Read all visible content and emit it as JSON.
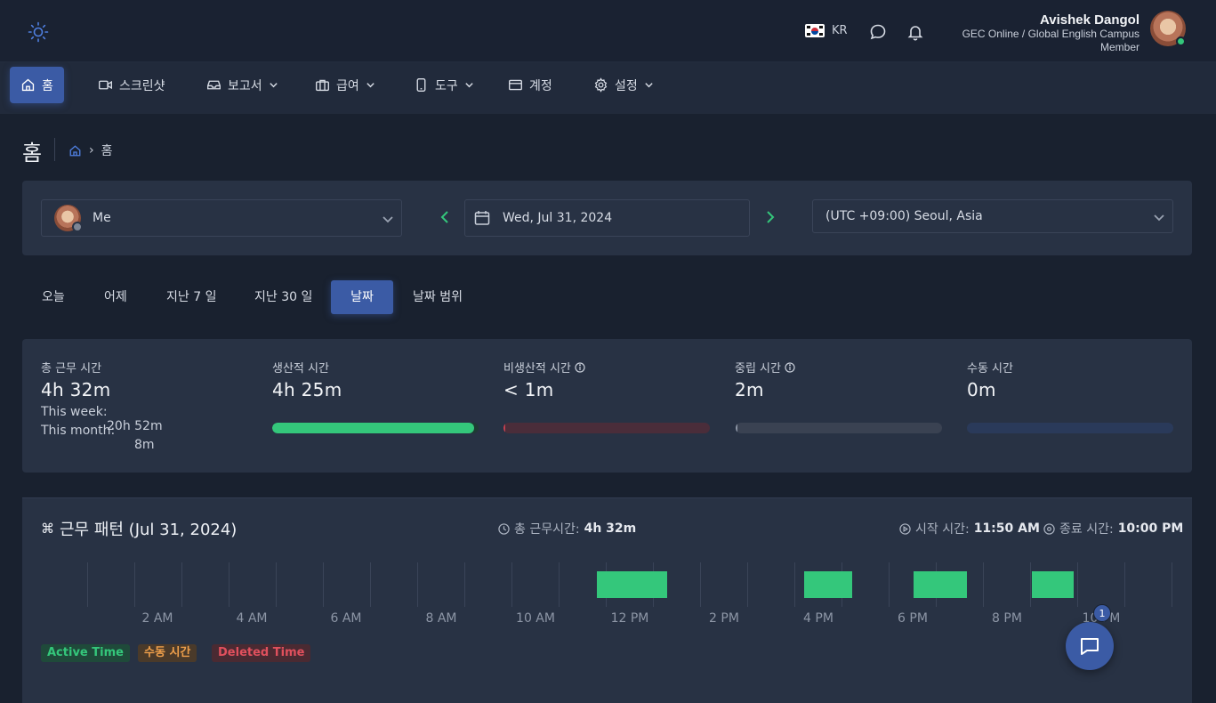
{
  "header": {
    "language_code": "KR",
    "user": {
      "name": "Avishek Dangol",
      "organization": "GEC Online / Global English Campus",
      "role": "Member"
    }
  },
  "nav": {
    "items": [
      {
        "label": "홈",
        "icon": "home-icon",
        "active": true
      },
      {
        "label": "스크린샷",
        "icon": "video-icon"
      },
      {
        "label": "보고서",
        "icon": "inbox-icon",
        "dropdown": true
      },
      {
        "label": "급여",
        "icon": "briefcase-icon",
        "dropdown": true
      },
      {
        "label": "도구",
        "icon": "phone-icon",
        "dropdown": true
      },
      {
        "label": "계정",
        "icon": "card-icon"
      },
      {
        "label": "설정",
        "icon": "gear-icon",
        "dropdown": true
      }
    ]
  },
  "page": {
    "title": "홈",
    "breadcrumb_current": "홈"
  },
  "filters": {
    "member": "Me",
    "date": "Wed, Jul 31, 2024",
    "timezone": "(UTC +09:00) Seoul, Asia"
  },
  "quick_tabs": [
    "오늘",
    "어제",
    "지난 7 일",
    "지난 30 일",
    "날짜",
    "날짜 범위"
  ],
  "quick_tab_active": "날짜",
  "stats": {
    "total": {
      "label": "총 근무 시간",
      "value": "4h 32m"
    },
    "this_week_label": "This week:",
    "this_week_value": "20h 52m",
    "this_month_label": "This month:",
    "this_month_value": "8m",
    "productive": {
      "label": "생산적 시간",
      "value": "4h 25m",
      "progress": 0.98,
      "color": "#34c77b"
    },
    "unproductive": {
      "label": "비생산적 시간",
      "value": "< 1m",
      "progress": 0.01,
      "color": "#c2404f"
    },
    "neutral": {
      "label": "중립 시간",
      "value": "2m",
      "progress": 0.01,
      "color": "#8d96a6"
    },
    "manual": {
      "label": "수동 시간",
      "value": "0m",
      "progress": 0,
      "color": "#3b5ba5"
    }
  },
  "pattern": {
    "title": "근무 패턴 (Jul 31, 2024)",
    "total_label": "총 근무시간:",
    "total_value": "4h 32m",
    "start_label": "시작 시간:",
    "start_value": "11:50 AM",
    "end_label": "종료 시간:",
    "end_value": "10:00 PM",
    "ticks": [
      "2 AM",
      "4 AM",
      "6 AM",
      "8 AM",
      "10 AM",
      "12 PM",
      "2 PM",
      "4 PM",
      "6 PM",
      "8 PM",
      "10 PM"
    ],
    "legend": [
      {
        "label": "Active Time",
        "color": "#34c77b"
      },
      {
        "label": "수동 시간",
        "color": "#f0a04b"
      },
      {
        "label": "Deleted Time",
        "color": "#e0505d"
      }
    ]
  },
  "chat": {
    "badge": "1"
  }
}
